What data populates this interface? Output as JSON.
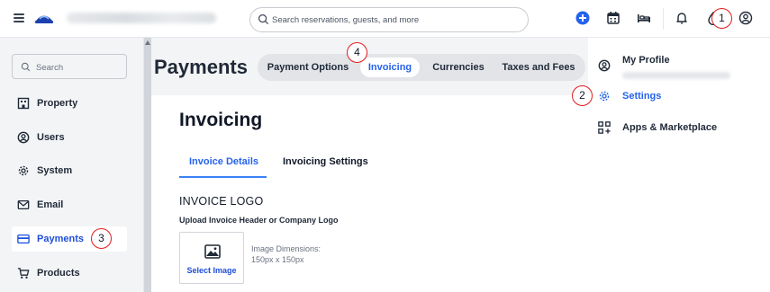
{
  "topbar": {
    "search_placeholder": "Search reservations, guests, and more",
    "icons": [
      "menu-icon",
      "logo-icon",
      "search-icon",
      "plus-circle-icon",
      "calendar-icon",
      "bed-icon",
      "bell-icon",
      "droplet-icon",
      "user-circle-icon"
    ],
    "accent_color": "#2563eb"
  },
  "sidebar": {
    "search_placeholder": "Search",
    "items": [
      {
        "label": "Property",
        "icon": "building-icon"
      },
      {
        "label": "Users",
        "icon": "user-circle-icon"
      },
      {
        "label": "System",
        "icon": "gear-icon"
      },
      {
        "label": "Email",
        "icon": "mail-icon"
      },
      {
        "label": "Payments",
        "icon": "credit-card-icon",
        "active": true
      },
      {
        "label": "Products",
        "icon": "cart-icon"
      }
    ]
  },
  "main": {
    "page_title": "Payments",
    "tabs": [
      {
        "label": "Payment Options"
      },
      {
        "label": "Invoicing",
        "active": true
      },
      {
        "label": "Currencies"
      },
      {
        "label": "Taxes and Fees"
      }
    ],
    "card": {
      "title": "Invoicing",
      "subtabs": [
        {
          "label": "Invoice Details",
          "active": true
        },
        {
          "label": "Invoicing Settings"
        }
      ],
      "section_heading": "INVOICE LOGO",
      "section_subheading": "Upload Invoice Header or Company Logo",
      "select_image_label": "Select Image",
      "dimensions_line1": "Image Dimensions:",
      "dimensions_line2": "150px x 150px"
    }
  },
  "dropdown": {
    "items": [
      {
        "label": "My Profile",
        "icon": "user-circle-icon"
      },
      {
        "label": "Settings",
        "icon": "gear-icon",
        "highlighted": true
      },
      {
        "label": "Apps & Marketplace",
        "icon": "apps-plus-icon"
      }
    ]
  },
  "callouts": [
    "1",
    "2",
    "3",
    "4"
  ],
  "callout_color": "#e11d1d"
}
